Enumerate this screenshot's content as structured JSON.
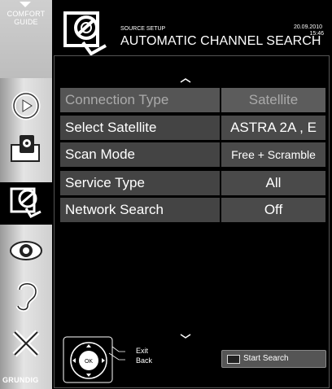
{
  "sidebar": {
    "guide_line1": "COMFORT",
    "guide_line2": "GUIDE",
    "brand": "GRUNDIG",
    "icons": [
      "playback-icon",
      "source-icon",
      "installation-icon",
      "picture-icon",
      "sound-icon",
      "tools-icon"
    ],
    "selected": "installation-icon"
  },
  "header": {
    "subtitle": "SOURCE SETUP",
    "title": "AUTOMATIC CHANNEL SEARCH",
    "date": "20.09.2010",
    "time": "15:46"
  },
  "settings": [
    {
      "label": "Connection Type",
      "value": "Satellite",
      "selected": true
    },
    {
      "label": "Select Satellite",
      "value": "ASTRA 2A , E",
      "selected": false
    },
    {
      "label": "Scan Mode",
      "value": "Free + Scramble",
      "selected": false
    },
    {
      "label": "Service Type",
      "value": "All",
      "selected": false
    },
    {
      "label": "Network Search",
      "value": "Off",
      "selected": false
    }
  ],
  "help": {
    "ok_label": "OK",
    "exit_label": "Exit",
    "back_label": "Back",
    "start_search_label": "Start Search"
  },
  "colors": {
    "row_label_bg": "#444444",
    "row_value_bg": "#4a4a4a",
    "sidebar_light": "#e4e4e4"
  }
}
